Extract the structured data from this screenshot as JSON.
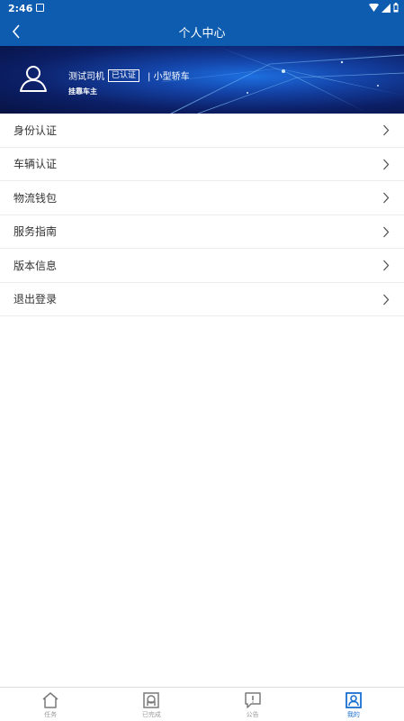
{
  "status_bar": {
    "time": "2:46"
  },
  "header": {
    "title": "个人中心"
  },
  "profile": {
    "name": "测试司机",
    "verified_badge": "已认证",
    "vehicle_type": "| 小型轿车",
    "subtitle": "挂靠车主"
  },
  "menu": {
    "items": [
      {
        "label": "身份认证"
      },
      {
        "label": "车辆认证"
      },
      {
        "label": "物流钱包"
      },
      {
        "label": "服务指南"
      },
      {
        "label": "版本信息"
      },
      {
        "label": "退出登录"
      }
    ]
  },
  "tabbar": {
    "tabs": [
      {
        "label": "任务",
        "icon": "home-icon"
      },
      {
        "label": "已完成",
        "icon": "completed-icon"
      },
      {
        "label": "公告",
        "icon": "notice-icon"
      },
      {
        "label": "我的",
        "icon": "profile-icon",
        "active": true
      }
    ]
  },
  "colors": {
    "primary": "#0d5cb0",
    "active_tab": "#1a6fd0"
  }
}
